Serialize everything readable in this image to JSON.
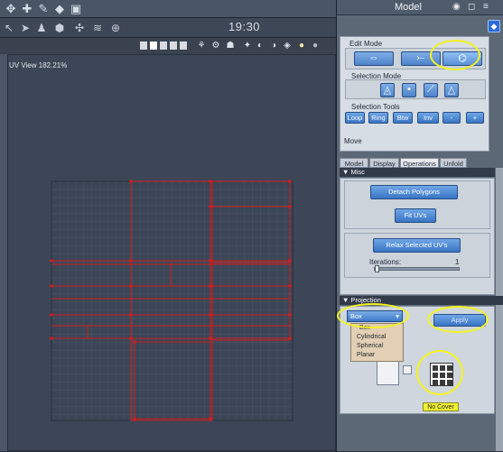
{
  "window": {
    "title": "Model",
    "clock": "19:30"
  },
  "view": {
    "label": "UV View 182.21%"
  },
  "edit_mode": {
    "label": "Edit Mode"
  },
  "selection_mode": {
    "label": "Selection Mode"
  },
  "selection_tools": {
    "label": "Selection Tools",
    "buttons": [
      "Loop",
      "Ring",
      "Btw",
      "Inv",
      "-",
      "+"
    ],
    "status": "Move"
  },
  "tabs": [
    "Model",
    "Display",
    "Operations",
    "Unfold"
  ],
  "active_tab": "Operations",
  "misc": {
    "header": "Misc",
    "detach": "Detach Polygons",
    "fit": "Fit UVs",
    "relax": "Relax Selected UV's",
    "iterations_label": "Iterations:",
    "iterations_value": "1"
  },
  "projection": {
    "header": "Projection",
    "selected": "Box",
    "apply": "Apply",
    "options": [
      "Box",
      "Cylindrical",
      "Spherical",
      "Planar"
    ],
    "tooltip": "No Cover"
  },
  "colors": {
    "accent": "#3a75c4",
    "highlight": "#f2f21e",
    "uv_edges": "#d21c1c"
  }
}
